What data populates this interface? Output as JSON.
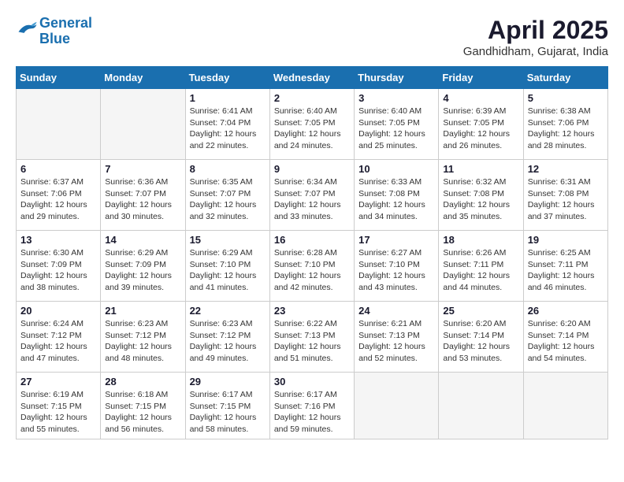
{
  "header": {
    "logo_line1": "General",
    "logo_line2": "Blue",
    "month": "April 2025",
    "location": "Gandhidham, Gujarat, India"
  },
  "weekdays": [
    "Sunday",
    "Monday",
    "Tuesday",
    "Wednesday",
    "Thursday",
    "Friday",
    "Saturday"
  ],
  "weeks": [
    [
      {
        "day": "",
        "info": ""
      },
      {
        "day": "",
        "info": ""
      },
      {
        "day": "1",
        "info": "Sunrise: 6:41 AM\nSunset: 7:04 PM\nDaylight: 12 hours and 22 minutes."
      },
      {
        "day": "2",
        "info": "Sunrise: 6:40 AM\nSunset: 7:05 PM\nDaylight: 12 hours and 24 minutes."
      },
      {
        "day": "3",
        "info": "Sunrise: 6:40 AM\nSunset: 7:05 PM\nDaylight: 12 hours and 25 minutes."
      },
      {
        "day": "4",
        "info": "Sunrise: 6:39 AM\nSunset: 7:05 PM\nDaylight: 12 hours and 26 minutes."
      },
      {
        "day": "5",
        "info": "Sunrise: 6:38 AM\nSunset: 7:06 PM\nDaylight: 12 hours and 28 minutes."
      }
    ],
    [
      {
        "day": "6",
        "info": "Sunrise: 6:37 AM\nSunset: 7:06 PM\nDaylight: 12 hours and 29 minutes."
      },
      {
        "day": "7",
        "info": "Sunrise: 6:36 AM\nSunset: 7:07 PM\nDaylight: 12 hours and 30 minutes."
      },
      {
        "day": "8",
        "info": "Sunrise: 6:35 AM\nSunset: 7:07 PM\nDaylight: 12 hours and 32 minutes."
      },
      {
        "day": "9",
        "info": "Sunrise: 6:34 AM\nSunset: 7:07 PM\nDaylight: 12 hours and 33 minutes."
      },
      {
        "day": "10",
        "info": "Sunrise: 6:33 AM\nSunset: 7:08 PM\nDaylight: 12 hours and 34 minutes."
      },
      {
        "day": "11",
        "info": "Sunrise: 6:32 AM\nSunset: 7:08 PM\nDaylight: 12 hours and 35 minutes."
      },
      {
        "day": "12",
        "info": "Sunrise: 6:31 AM\nSunset: 7:08 PM\nDaylight: 12 hours and 37 minutes."
      }
    ],
    [
      {
        "day": "13",
        "info": "Sunrise: 6:30 AM\nSunset: 7:09 PM\nDaylight: 12 hours and 38 minutes."
      },
      {
        "day": "14",
        "info": "Sunrise: 6:29 AM\nSunset: 7:09 PM\nDaylight: 12 hours and 39 minutes."
      },
      {
        "day": "15",
        "info": "Sunrise: 6:29 AM\nSunset: 7:10 PM\nDaylight: 12 hours and 41 minutes."
      },
      {
        "day": "16",
        "info": "Sunrise: 6:28 AM\nSunset: 7:10 PM\nDaylight: 12 hours and 42 minutes."
      },
      {
        "day": "17",
        "info": "Sunrise: 6:27 AM\nSunset: 7:10 PM\nDaylight: 12 hours and 43 minutes."
      },
      {
        "day": "18",
        "info": "Sunrise: 6:26 AM\nSunset: 7:11 PM\nDaylight: 12 hours and 44 minutes."
      },
      {
        "day": "19",
        "info": "Sunrise: 6:25 AM\nSunset: 7:11 PM\nDaylight: 12 hours and 46 minutes."
      }
    ],
    [
      {
        "day": "20",
        "info": "Sunrise: 6:24 AM\nSunset: 7:12 PM\nDaylight: 12 hours and 47 minutes."
      },
      {
        "day": "21",
        "info": "Sunrise: 6:23 AM\nSunset: 7:12 PM\nDaylight: 12 hours and 48 minutes."
      },
      {
        "day": "22",
        "info": "Sunrise: 6:23 AM\nSunset: 7:12 PM\nDaylight: 12 hours and 49 minutes."
      },
      {
        "day": "23",
        "info": "Sunrise: 6:22 AM\nSunset: 7:13 PM\nDaylight: 12 hours and 51 minutes."
      },
      {
        "day": "24",
        "info": "Sunrise: 6:21 AM\nSunset: 7:13 PM\nDaylight: 12 hours and 52 minutes."
      },
      {
        "day": "25",
        "info": "Sunrise: 6:20 AM\nSunset: 7:14 PM\nDaylight: 12 hours and 53 minutes."
      },
      {
        "day": "26",
        "info": "Sunrise: 6:20 AM\nSunset: 7:14 PM\nDaylight: 12 hours and 54 minutes."
      }
    ],
    [
      {
        "day": "27",
        "info": "Sunrise: 6:19 AM\nSunset: 7:15 PM\nDaylight: 12 hours and 55 minutes."
      },
      {
        "day": "28",
        "info": "Sunrise: 6:18 AM\nSunset: 7:15 PM\nDaylight: 12 hours and 56 minutes."
      },
      {
        "day": "29",
        "info": "Sunrise: 6:17 AM\nSunset: 7:15 PM\nDaylight: 12 hours and 58 minutes."
      },
      {
        "day": "30",
        "info": "Sunrise: 6:17 AM\nSunset: 7:16 PM\nDaylight: 12 hours and 59 minutes."
      },
      {
        "day": "",
        "info": ""
      },
      {
        "day": "",
        "info": ""
      },
      {
        "day": "",
        "info": ""
      }
    ]
  ]
}
